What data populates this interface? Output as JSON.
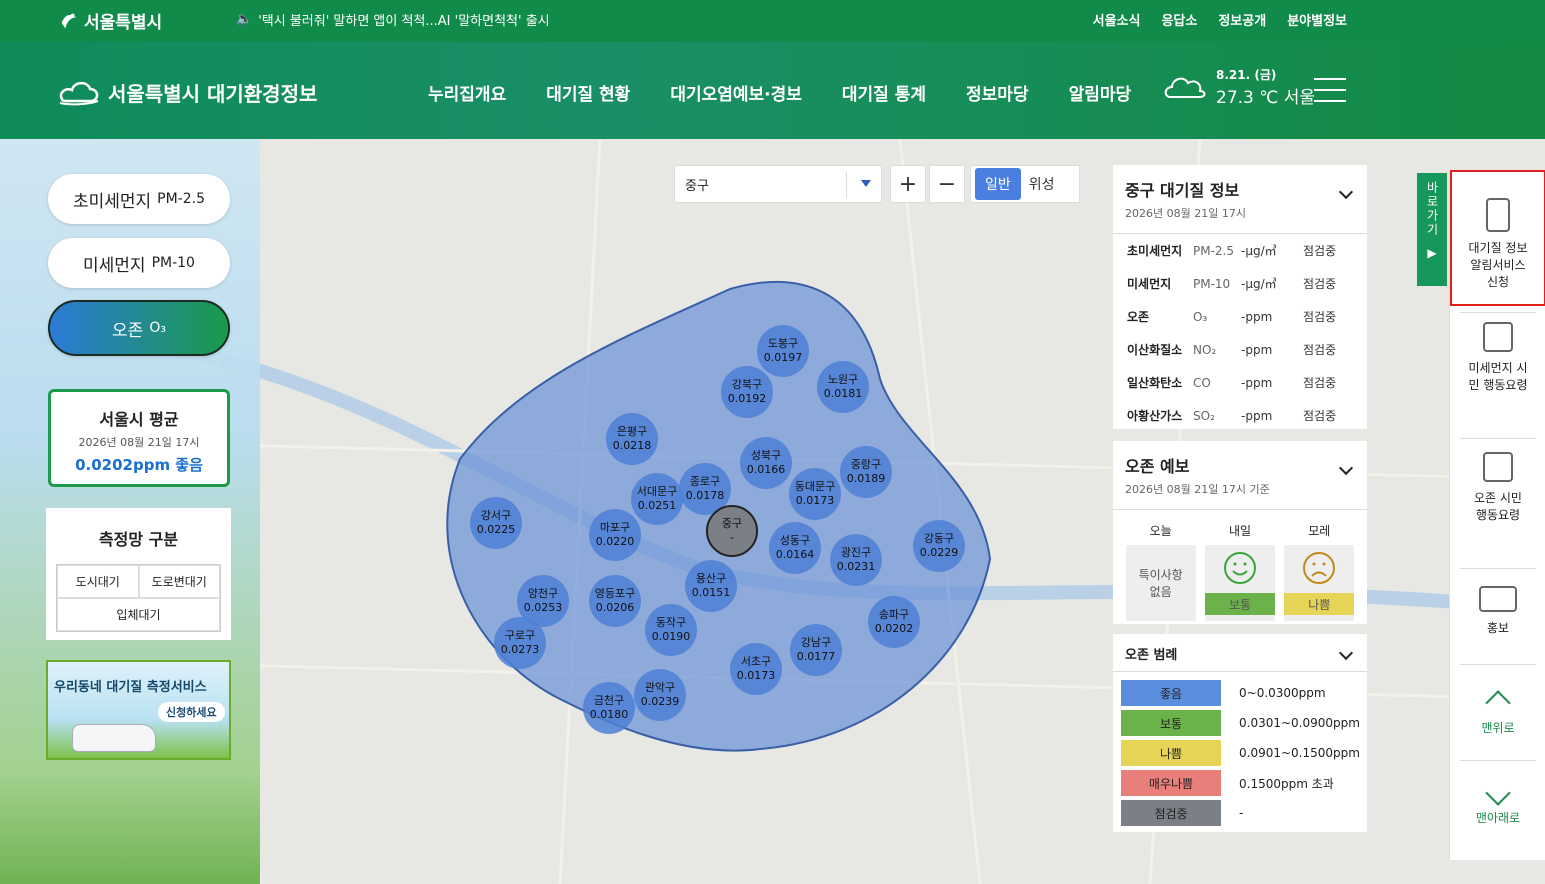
{
  "topbar": {
    "logo": "서울특별시",
    "notice": "'택시 불러줘' 말하면 앱이 척척...AI '말하면척척' 출시",
    "links": [
      "서울소식",
      "응답소",
      "정보공개",
      "분야별정보"
    ]
  },
  "header": {
    "site_title": "서울특별시 대기환경정보",
    "menu": [
      "누리집개요",
      "대기질 현황",
      "대기오염예보·경보",
      "대기질 통계",
      "정보마당",
      "알림마당"
    ],
    "weather_date": "8.21. (금)",
    "weather_temp": "27.3 ℃ 서울"
  },
  "sidebar": {
    "pills": [
      {
        "label": "초미세먼지",
        "sub": "PM-2.5"
      },
      {
        "label": "미세먼지",
        "sub": "PM-10"
      },
      {
        "label": "오존",
        "sub": "O₃"
      }
    ],
    "avg": {
      "title": "서울시 평균",
      "date": "2026년 08월 21일 17시",
      "value": "0.0202ppm  좋음"
    },
    "network": {
      "title": "측정망 구분",
      "items": [
        "도시대기",
        "도로변대기",
        "입체대기"
      ]
    },
    "banner": {
      "title": "우리동네 대기질 측정서비스",
      "button": "신청하세요"
    }
  },
  "map_controls": {
    "district_select": "중구",
    "zoom_in": "+",
    "zoom_out": "−",
    "type_normal": "일반",
    "type_satellite": "위성"
  },
  "districts": [
    {
      "name": "도봉구",
      "value": "0.0197"
    },
    {
      "name": "강북구",
      "value": "0.0192"
    },
    {
      "name": "노원구",
      "value": "0.0181"
    },
    {
      "name": "은평구",
      "value": "0.0218"
    },
    {
      "name": "성북구",
      "value": "0.0166"
    },
    {
      "name": "중랑구",
      "value": "0.0189"
    },
    {
      "name": "종로구",
      "value": "0.0178"
    },
    {
      "name": "서대문구",
      "value": "0.0251"
    },
    {
      "name": "동대문구",
      "value": "0.0173"
    },
    {
      "name": "강서구",
      "value": "0.0225"
    },
    {
      "name": "마포구",
      "value": "0.0220"
    },
    {
      "name": "중구",
      "value": "-"
    },
    {
      "name": "성동구",
      "value": "0.0164"
    },
    {
      "name": "광진구",
      "value": "0.0231"
    },
    {
      "name": "강동구",
      "value": "0.0229"
    },
    {
      "name": "용산구",
      "value": "0.0151"
    },
    {
      "name": "양천구",
      "value": "0.0253"
    },
    {
      "name": "영등포구",
      "value": "0.0206"
    },
    {
      "name": "동작구",
      "value": "0.0190"
    },
    {
      "name": "구로구",
      "value": "0.0273"
    },
    {
      "name": "송파구",
      "value": "0.0202"
    },
    {
      "name": "강남구",
      "value": "0.0177"
    },
    {
      "name": "관악구",
      "value": "0.0239"
    },
    {
      "name": "서초구",
      "value": "0.0173"
    },
    {
      "name": "금천구",
      "value": "0.0180"
    }
  ],
  "air_info": {
    "title": "중구 대기질 정보",
    "date": "2026년 08월 21일 17시",
    "rows": [
      {
        "name": "초미세먼지",
        "code": "PM-2.5",
        "unit": "-μg/㎥",
        "status": "점검중"
      },
      {
        "name": "미세먼지",
        "code": "PM-10",
        "unit": "-μg/㎥",
        "status": "점검중"
      },
      {
        "name": "오존",
        "code": "O₃",
        "unit": "-ppm",
        "status": "점검중"
      },
      {
        "name": "이산화질소",
        "code": "NO₂",
        "unit": "-ppm",
        "status": "점검중"
      },
      {
        "name": "일산화탄소",
        "code": "CO",
        "unit": "-ppm",
        "status": "점검중"
      },
      {
        "name": "아황산가스",
        "code": "SO₂",
        "unit": "-ppm",
        "status": "점검중"
      }
    ]
  },
  "forecast": {
    "title": "오존 예보",
    "date": "2026년 08월 21일 17시 기준",
    "days": [
      {
        "label": "오늘",
        "text": "특이사항\n없음"
      },
      {
        "label": "내일",
        "status": "보통",
        "color": "#6bb24a",
        "face": "smile"
      },
      {
        "label": "모레",
        "status": "나쁨",
        "color": "#e5d455",
        "face": "frown"
      }
    ]
  },
  "legend": {
    "title": "오존 범례",
    "items": [
      {
        "label": "좋음",
        "range": "0~0.0300ppm",
        "color": "#5b8fdd"
      },
      {
        "label": "보통",
        "range": "0.0301~0.0900ppm",
        "color": "#6bb24a"
      },
      {
        "label": "나쁨",
        "range": "0.0901~0.1500ppm",
        "color": "#e5d455"
      },
      {
        "label": "매우나쁨",
        "range": "0.1500ppm 초과",
        "color": "#e97f7a"
      },
      {
        "label": "점검중",
        "range": "-",
        "color": "#7b7f86"
      }
    ]
  },
  "quick_menu": {
    "tab_label": "바로가기",
    "items": [
      "대기질 정보 알림서비스 신청",
      "미세먼지 시민 행동요령",
      "오존 시민 행동요령",
      "홍보"
    ],
    "top": "맨위로",
    "bottom": "맨아래로"
  }
}
